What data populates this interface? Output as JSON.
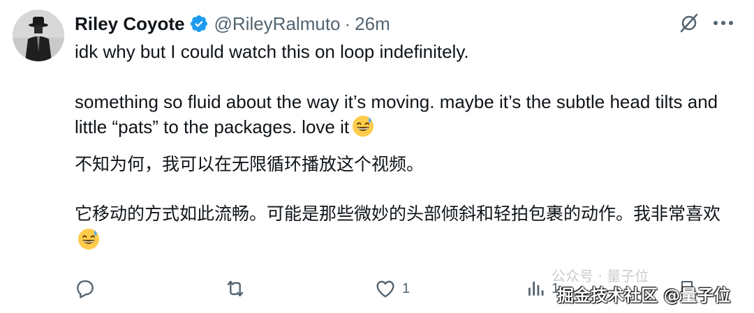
{
  "tweet": {
    "author": {
      "display_name": "Riley Coyote",
      "handle": "@RileyRalmuto",
      "verified": true
    },
    "separator": "·",
    "timestamp": "26m",
    "text": {
      "line1": "idk why but I could watch this on loop indefinitely.",
      "line2": "something so fluid about the way it’s moving. maybe it’s the subtle head tilts and little “pats” to the packages. love it",
      "line3": "不知为何，我可以在无限循环播放这个视频。",
      "line4": "它移动的方式如此流畅。可能是那些微妙的头部倾斜和轻拍包裹的动作。我非常喜欢"
    },
    "emoji": "grinning-face-with-sweat"
  },
  "actions": {
    "reply_count": "",
    "repost_count": "",
    "like_count": "1",
    "views_count": "1"
  },
  "watermarks": {
    "top": "公众号 · 量子位",
    "bottom": "掘金技术社区 @量子位"
  },
  "colors": {
    "text_primary": "#0f1419",
    "text_secondary": "#536471",
    "verified_blue": "#1d9bf0",
    "background": "#ffffff"
  }
}
